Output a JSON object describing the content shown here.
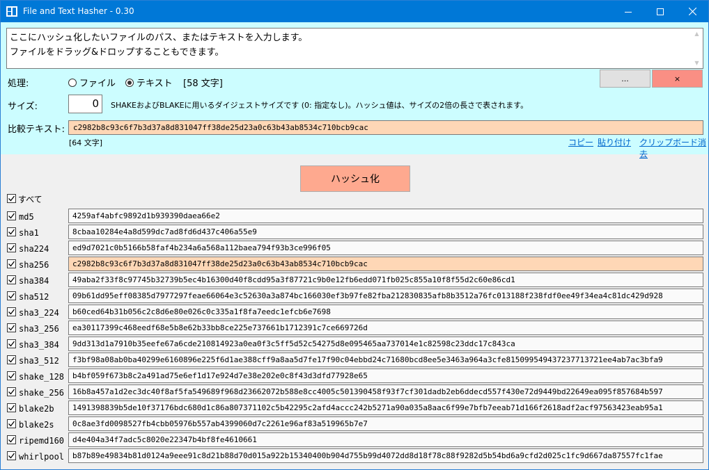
{
  "window": {
    "title": "File and Text Hasher - 0.30"
  },
  "input": {
    "line1": "ここにハッシュ化したいファイルのパス、またはテキストを入力します。",
    "line2": "ファイルをドラッグ&ドロップすることもできます。"
  },
  "process": {
    "label": "処理:",
    "option_file": "ファイル",
    "option_text": "テキスト",
    "selected": "テキスト",
    "char_count": "[58 文字]"
  },
  "buttons": {
    "browse": "...",
    "clear": "×",
    "hash": "ハッシュ化"
  },
  "size": {
    "label": "サイズ:",
    "value": "0",
    "description": "SHAKEおよびBLAKEに用いるダイジェストサイズです (0: 指定なし)。ハッシュ値は、サイズの2倍の長さで表されます。"
  },
  "compare": {
    "label": "比較テキスト:",
    "value": "c2982b8c93c6f7b3d37a8d831047ff38de25d23a0c63b43ab8534c710bcb9cac",
    "char_count": "[64 文字]",
    "link_copy": "コピー",
    "link_paste": "貼り付け",
    "link_clear_clipboard": "クリップボード消去",
    "highlight_color": "#fed7b6"
  },
  "select_all": {
    "label": "すべて",
    "checked": true
  },
  "hashes": [
    {
      "name": "md5",
      "value": "4259af4abfc9892d1b939390daea66e2",
      "checked": true,
      "match": false
    },
    {
      "name": "sha1",
      "value": "8cbaa10284e4a8d599dc7ad8fd6d437c406a55e9",
      "checked": true,
      "match": false
    },
    {
      "name": "sha224",
      "value": "ed9d7021c0b5166b58faf4b234a6a568a112baea794f93b3ce996f05",
      "checked": true,
      "match": false
    },
    {
      "name": "sha256",
      "value": "c2982b8c93c6f7b3d37a8d831047ff38de25d23a0c63b43ab8534c710bcb9cac",
      "checked": true,
      "match": true
    },
    {
      "name": "sha384",
      "value": "49aba2f33f8c97745b32739b5ec4b16300d40f8cdd95a3f87721c9b0e12fb6edd071fb025c855a10f8f55d2c60e86cd1",
      "checked": true,
      "match": false
    },
    {
      "name": "sha512",
      "value": "09b61dd95eff08385d7977297feae66064e3c52630a3a874bc166030ef3b97fe82fba212830835afb8b3512a76fc013188f238fdf0ee49f34ea4c81dc429d928",
      "checked": true,
      "match": false
    },
    {
      "name": "sha3_224",
      "value": "b60ced64b31b056c2c8d6e80e026c0c335a1f8fa7eedc1efcb6e7698",
      "checked": true,
      "match": false
    },
    {
      "name": "sha3_256",
      "value": "ea30117399c468eedf68e5b8e62b33bb8ce225e737661b1712391c7ce669726d",
      "checked": true,
      "match": false
    },
    {
      "name": "sha3_384",
      "value": "9dd313d1a7910b35eefe67a6cde210814923a0ea0f3c5ff5d52c54275d8e095465aa737014e1c82598c23ddc17c843ca",
      "checked": true,
      "match": false
    },
    {
      "name": "sha3_512",
      "value": "f3bf98a08ab0ba40299e6160896e225f6d1ae388cff9a8aa5d7fe17f90c04ebbd24c71680bcd8ee5e3463a964a3cfe815099549437237713721ee4ab7ac3bfa9",
      "checked": true,
      "match": false
    },
    {
      "name": "shake_128",
      "value": "b4bf059f673b8c2a491ad75e6ef1d17e924d7e38e202e0c8f43d3dfd77928e65",
      "checked": true,
      "match": false
    },
    {
      "name": "shake_256",
      "value": "16b8a457a1d2ec3dc40f8af5fa549689f968d23662072b588e8cc4005c501390458f93f7cf301dadb2eb6ddecd557f430e72d9449bd22649ea095f857684b597",
      "checked": true,
      "match": false
    },
    {
      "name": "blake2b",
      "value": "1491398839b5de10f37176bdc680d1c86a807371102c5b42295c2afd4accc242b5271a90a035a8aac6f99e7bfb7eeab71d166f2618adf2acf97563423eab95a1",
      "checked": true,
      "match": false
    },
    {
      "name": "blake2s",
      "value": "0c8ae3fd0098527fb4cbb05976b557ab4399060d7c2261e96af83a519965b7e7",
      "checked": true,
      "match": false
    },
    {
      "name": "ripemd160",
      "value": "d4e404a34f7adc5c8020e22347b4bf8fe4610661",
      "checked": true,
      "match": false
    },
    {
      "name": "whirlpool",
      "value": "b87b89e49834b81d0124a9eee91c8d21b88d70d015a922b15340400b904d755b99d4072dd8d18f78c88f9282d5b54bd6a9cfd2d025c1fc9d667da87557fc1fae",
      "checked": true,
      "match": false
    }
  ],
  "colors": {
    "title_bar": "#0078d7",
    "upper_panel": "#ccfdff",
    "hash_button": "#fea98f",
    "clear_button": "#fa8f84",
    "match_highlight": "#fed7b6"
  }
}
